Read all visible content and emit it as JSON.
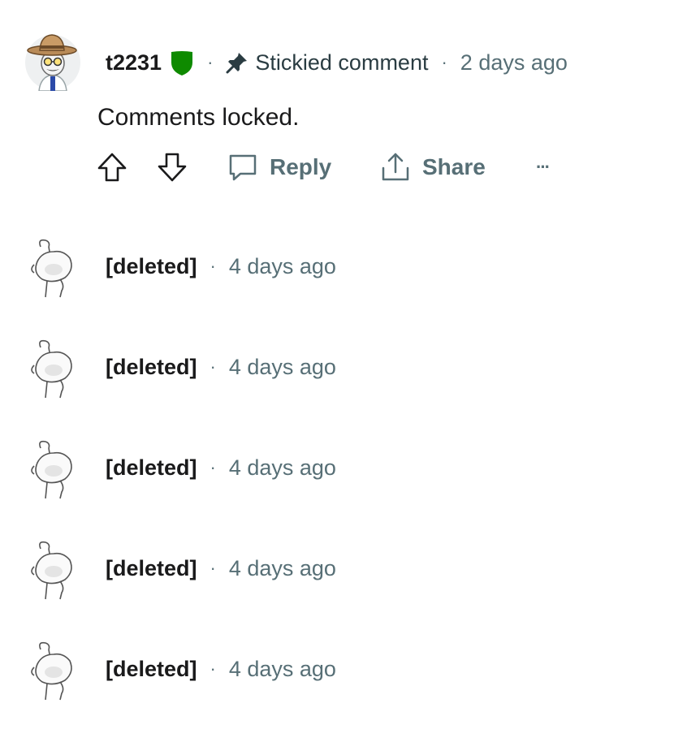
{
  "sticky_comment": {
    "username": "t2231",
    "badge_color": "#0e8a00",
    "separator": "·",
    "pin_icon": "pin-icon",
    "sticky_label": "Stickied comment",
    "timestamp": "2 days ago",
    "body": "Comments locked.",
    "actions": {
      "upvote_icon": "arrow-up-icon",
      "downvote_icon": "arrow-down-icon",
      "reply_label": "Reply",
      "share_label": "Share",
      "more_label": "···"
    }
  },
  "deleted_comments": [
    {
      "author": "[deleted]",
      "separator": "·",
      "timestamp": "4 days ago"
    },
    {
      "author": "[deleted]",
      "separator": "·",
      "timestamp": "4 days ago"
    },
    {
      "author": "[deleted]",
      "separator": "·",
      "timestamp": "4 days ago"
    },
    {
      "author": "[deleted]",
      "separator": "·",
      "timestamp": "4 days ago"
    },
    {
      "author": "[deleted]",
      "separator": "·",
      "timestamp": "4 days ago"
    }
  ],
  "colors": {
    "text_primary": "#1a1a1b",
    "text_secondary": "#576f76",
    "mod_green": "#0e8a00"
  }
}
